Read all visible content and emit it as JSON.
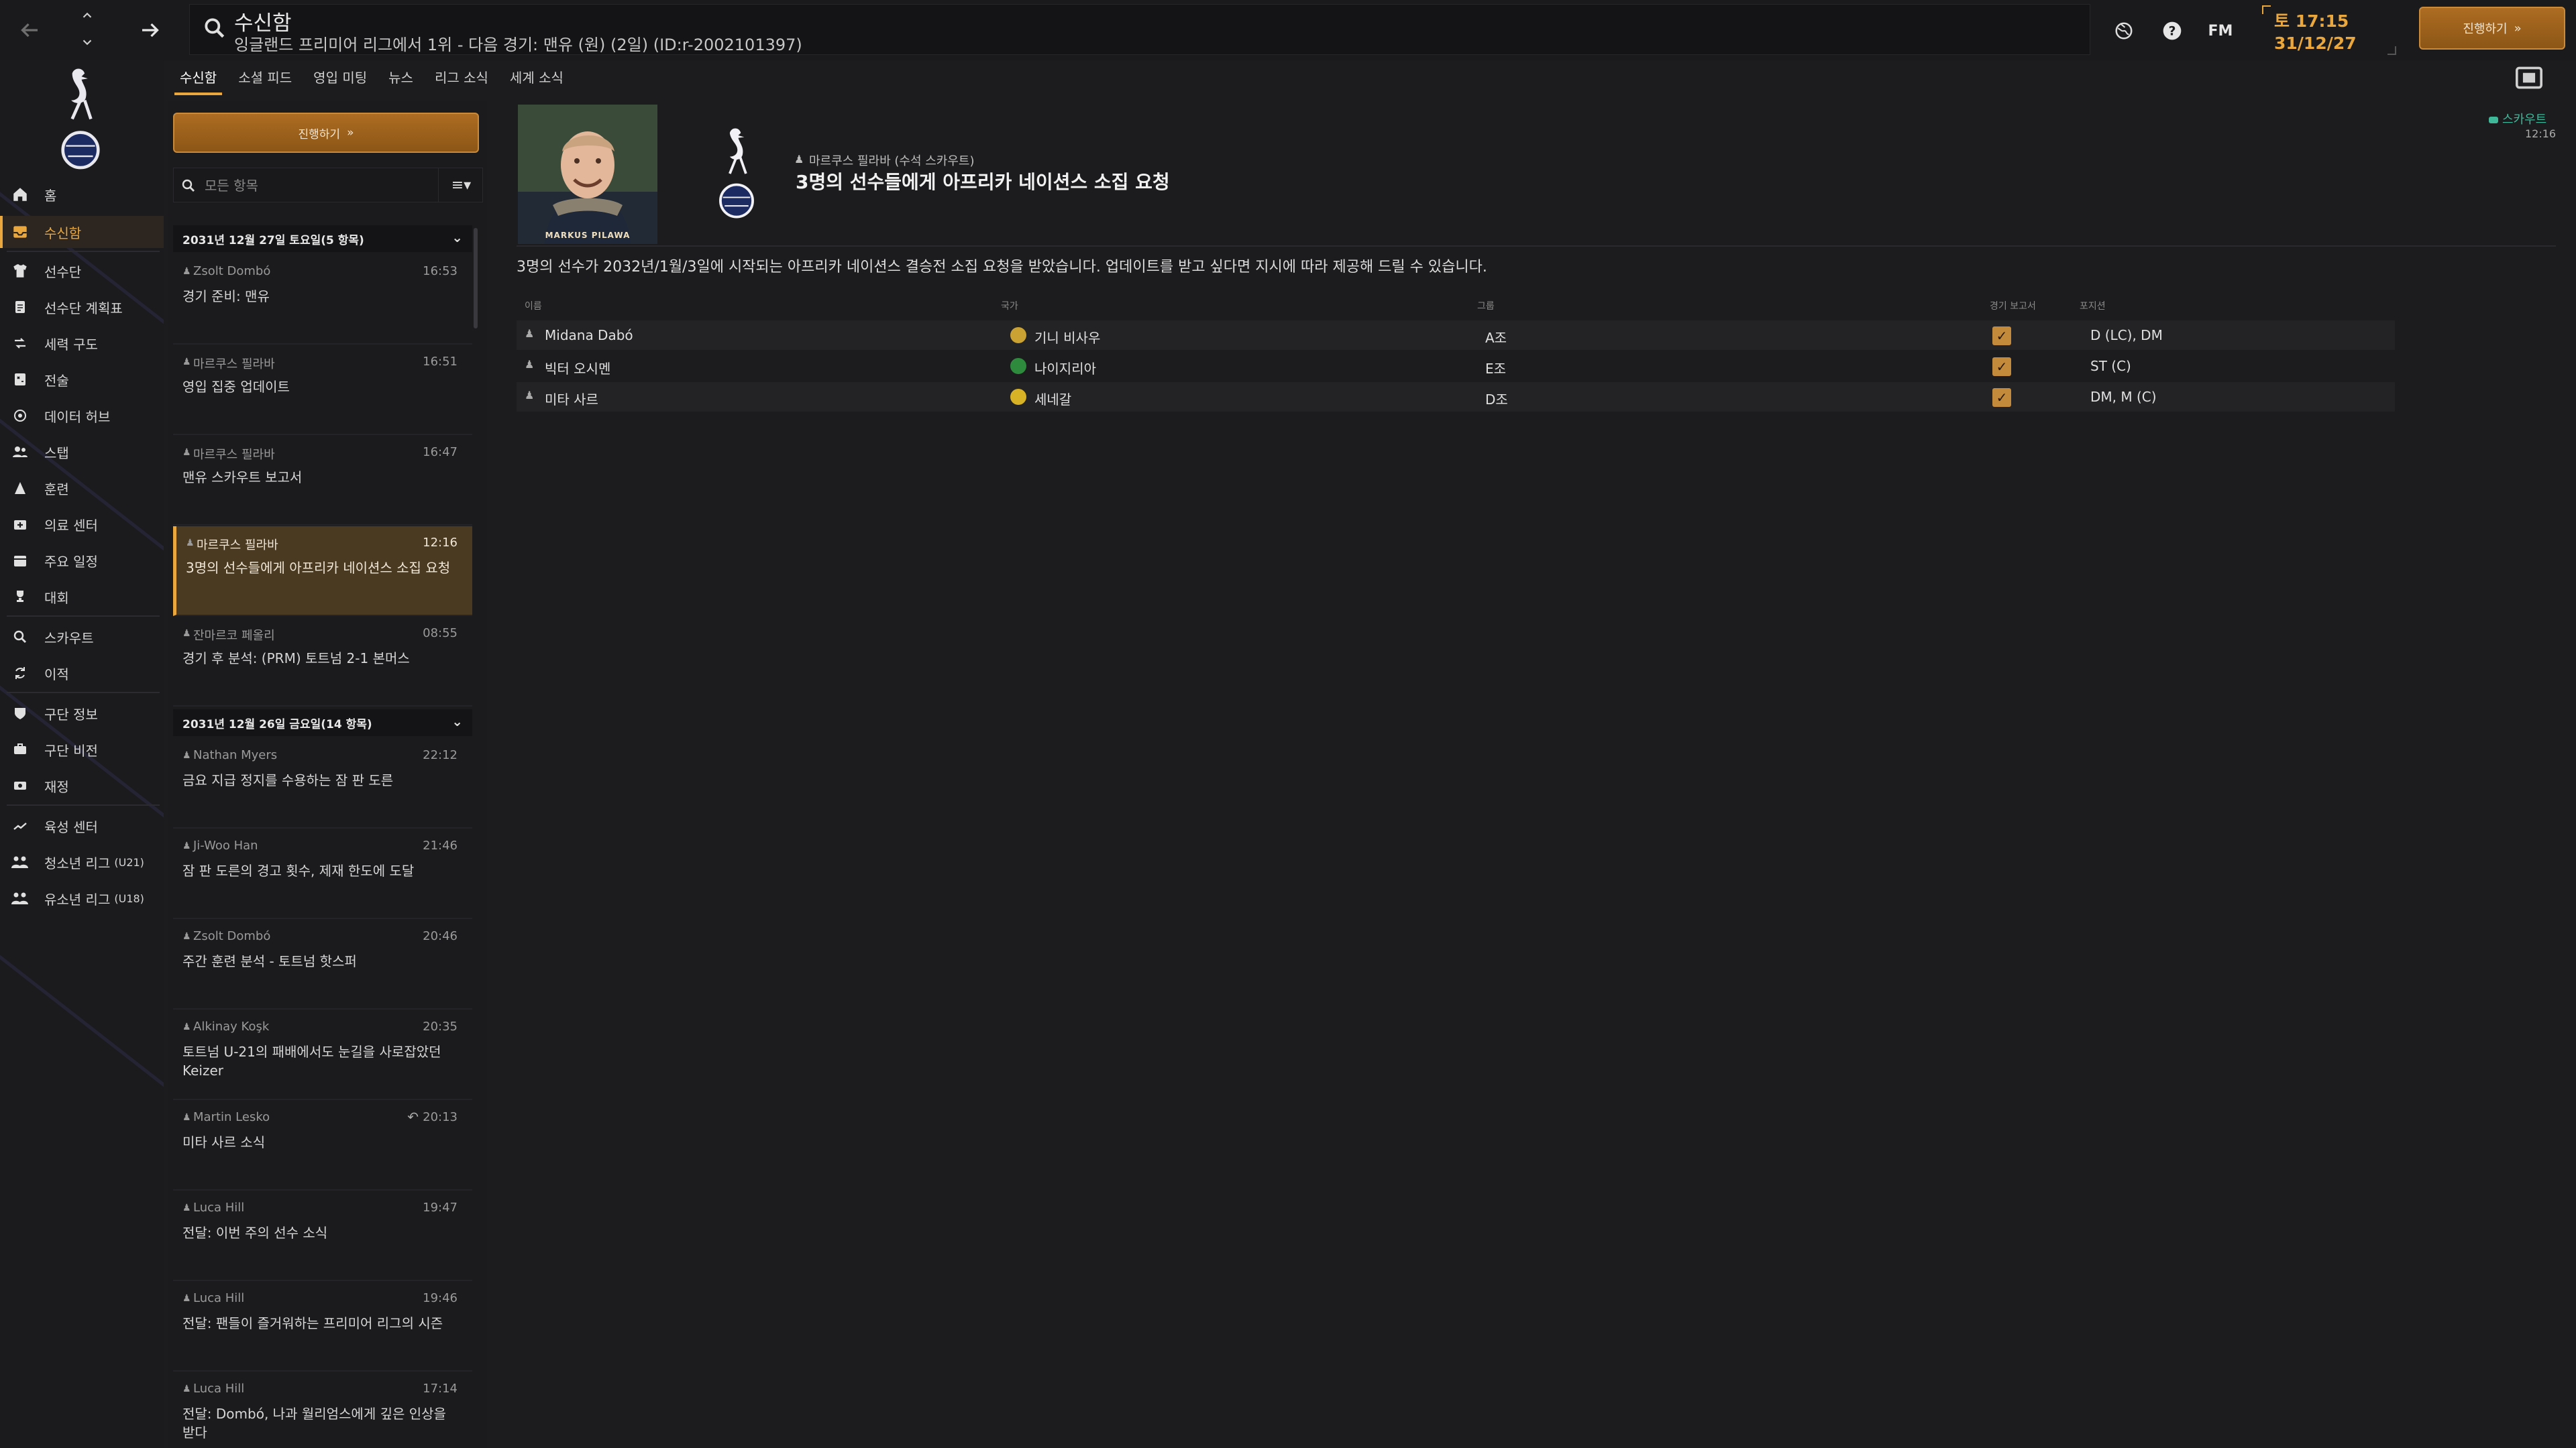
{
  "topbar": {
    "title": "수신함",
    "subtitle": "잉글랜드 프리미어 리그에서 1위 - 다음 경기: 맨유 (원) (2일) (ID:r-2002101397)",
    "fm_label": "FM",
    "date_day": "토 17:15",
    "date_date": "31/12/27",
    "continue_label": "진행하기"
  },
  "sidebar": {
    "items": [
      {
        "label": "홈",
        "icon": "home-icon"
      },
      {
        "label": "수신함",
        "icon": "inbox-icon"
      },
      {
        "label": "선수단",
        "icon": "shirt-icon"
      },
      {
        "label": "선수단 계획표",
        "icon": "clipboard-icon"
      },
      {
        "label": "세력 구도",
        "icon": "dynamics-icon"
      },
      {
        "label": "전술",
        "icon": "tactics-icon"
      },
      {
        "label": "데이터 허브",
        "icon": "data-hub-icon"
      },
      {
        "label": "스탭",
        "icon": "staff-icon"
      },
      {
        "label": "훈련",
        "icon": "training-icon"
      },
      {
        "label": "의료 센터",
        "icon": "medical-icon"
      },
      {
        "label": "주요 일정",
        "icon": "calendar-icon"
      },
      {
        "label": "대회",
        "icon": "trophy-icon"
      },
      {
        "label": "스카우트",
        "icon": "scout-icon"
      },
      {
        "label": "이적",
        "icon": "transfer-icon"
      },
      {
        "label": "구단 정보",
        "icon": "club-info-icon"
      },
      {
        "label": "구단 비전",
        "icon": "club-vision-icon"
      },
      {
        "label": "재정",
        "icon": "finance-icon"
      },
      {
        "label": "육성 센터",
        "icon": "development-icon"
      },
      {
        "label": "청소년 리그",
        "badge": "(U21)",
        "icon": "youth-icon"
      },
      {
        "label": "유소년 리그",
        "badge": "(U18)",
        "icon": "youth-icon"
      }
    ]
  },
  "tabs": [
    "수신함",
    "소셜 피드",
    "영입 미팅",
    "뉴스",
    "리그 소식",
    "세계 소식"
  ],
  "inbox": {
    "continue_label": "진행하기",
    "filter_placeholder": "모든 항목",
    "day1_header": "2031년 12월 27일 토요일(5 항목)",
    "day2_header": "2031년 12월 26일 금요일(14 항목)",
    "messages_day1": [
      {
        "sender": "Zsolt Dombó",
        "time": "16:53",
        "subject": "경기 준비: 맨유"
      },
      {
        "sender": "마르쿠스 필라바",
        "time": "16:51",
        "subject": "영입 집중 업데이트"
      },
      {
        "sender": "마르쿠스 필라바",
        "time": "16:47",
        "subject": "맨유 스카우트 보고서"
      },
      {
        "sender": "마르쿠스 필라바",
        "time": "12:16",
        "subject": "3명의 선수들에게 아프리카 네이션스 소집 요청"
      },
      {
        "sender": "잔마르코 페올리",
        "time": "08:55",
        "subject": "경기 후 분석: (PRM) 토트넘 2-1 본머스"
      }
    ],
    "messages_day2": [
      {
        "sender": "Nathan Myers",
        "time": "22:12",
        "subject": "금요 지급 정지를 수용하는 잠 판 도른"
      },
      {
        "sender": "Ji-Woo Han",
        "time": "21:46",
        "subject": "잠 판 도른의 경고 횟수, 제재 한도에 도달"
      },
      {
        "sender": "Zsolt Dombó",
        "time": "20:46",
        "subject": "주간 훈련 분석 - 토트넘 핫스퍼"
      },
      {
        "sender": "Alkinay Koşk",
        "time": "20:35",
        "subject": "토트넘 U-21의 패배에서도 눈길을 사로잡았던 Keizer"
      },
      {
        "sender": "Martin Lesko",
        "time": "20:13",
        "subject": "미타 사르 소식"
      },
      {
        "sender": "Luca Hill",
        "time": "19:47",
        "subject": "전달: 이번 주의 선수 소식"
      },
      {
        "sender": "Luca Hill",
        "time": "19:46",
        "subject": "전달: 팬들이 즐거워하는 프리미어 리그의 시즌"
      },
      {
        "sender": "Luca Hill",
        "time": "17:14",
        "subject": "전달: Dombó, 나과 월리엄스에게 깊은 인상을 받다"
      }
    ]
  },
  "detail": {
    "photo_caption": "MARKUS PILAWA",
    "from": "마르쿠스 필라바 (수석 스카우트)",
    "subject": "3명의 선수들에게 아프리카 네이션스 소집 요청",
    "badge": "스카우트",
    "badge_time": "12:16",
    "body": "3명의 선수가 2032년/1월/3일에 시작되는 아프리카 네이션스 결승전 소집 요청을 받았습니다. 업데이트를 받고 싶다면 지시에 따라 제공해 드릴 수 있습니다.",
    "columns": [
      "이름",
      "국가",
      "그룹",
      "경기 보고서",
      "포지션"
    ],
    "players": [
      {
        "name": "Midana Dabó",
        "nation": "기니 비사우",
        "group": "A조",
        "position": "D (LC), DM",
        "flag": "#caa233"
      },
      {
        "name": "빅터 오시멘",
        "nation": "나이지리아",
        "group": "E조",
        "position": "ST (C)",
        "flag": "#2e8b3d"
      },
      {
        "name": "미타 사르",
        "nation": "세네갈",
        "group": "D조",
        "position": "DM, M (C)",
        "flag": "#d7b226"
      }
    ]
  },
  "colors": {
    "accent": "#e9a73d",
    "background": "#1c1c1e",
    "scout": "#3fb89a"
  }
}
